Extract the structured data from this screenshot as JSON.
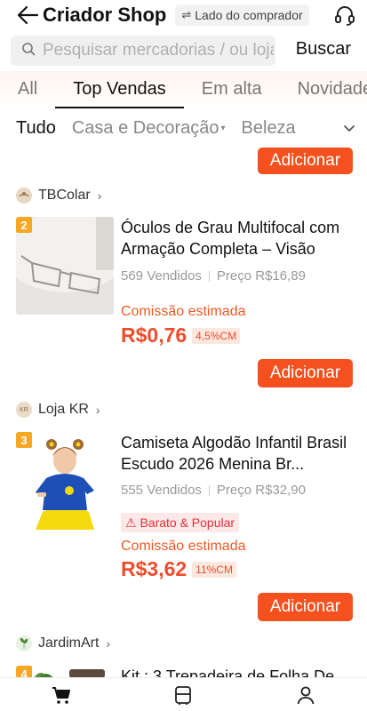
{
  "header": {
    "title": "Criador Shop",
    "buyer_chip": "Lado do comprador",
    "swap_glyph": "⇌"
  },
  "search": {
    "placeholder": "Pesquisar mercadorias / ou lojas",
    "button": "Buscar"
  },
  "tabs": [
    {
      "label": "All",
      "active": false
    },
    {
      "label": "Top Vendas",
      "active": true
    },
    {
      "label": "Em alta",
      "active": false
    },
    {
      "label": "Novidades",
      "active": false
    }
  ],
  "categories": [
    {
      "label": "Tudo",
      "active": true
    },
    {
      "label": "Casa e Decoração",
      "caret": "▾"
    },
    {
      "label": "Beleza"
    }
  ],
  "add_button_label": "Adicionar",
  "products": [
    {
      "shop": "TBColar",
      "rank": "2",
      "title": "Óculos de Grau Multifocal com Armação Completa – Visão",
      "sold": "569 Vendidos",
      "price": "Preço R$16,89",
      "commission_label": "Comissão estimada",
      "commission_value": "R$0,76",
      "commission_pct": "4,5%CM"
    },
    {
      "shop": "Loja KR",
      "shop_logo_text": "KR",
      "rank": "3",
      "title": "Camiseta Algodão Infantil Brasil Escudo 2026 Menina Br...",
      "sold": "555 Vendidos",
      "price": "Preço R$32,90",
      "tag": "⚠ Barato & Popular",
      "commission_label": "Comissão estimada",
      "commission_value": "R$3,62",
      "commission_pct": "11%CM"
    },
    {
      "shop": "JardimArt",
      "rank": "4",
      "title": "Kit : 3 Trepadeira de Folha De"
    }
  ],
  "icons": {
    "back": "back-arrow-icon",
    "headset": "headset-icon",
    "search": "search-icon",
    "more": "chevron-down-icon",
    "nav_cart": "cart-icon",
    "nav_list": "list-icon",
    "nav_profile": "person-icon"
  },
  "colors": {
    "accent": "#f5511e",
    "commission": "#ee4d2d",
    "rank_badge": "#f7a823",
    "popular_tag_bg": "#fde8e8"
  }
}
